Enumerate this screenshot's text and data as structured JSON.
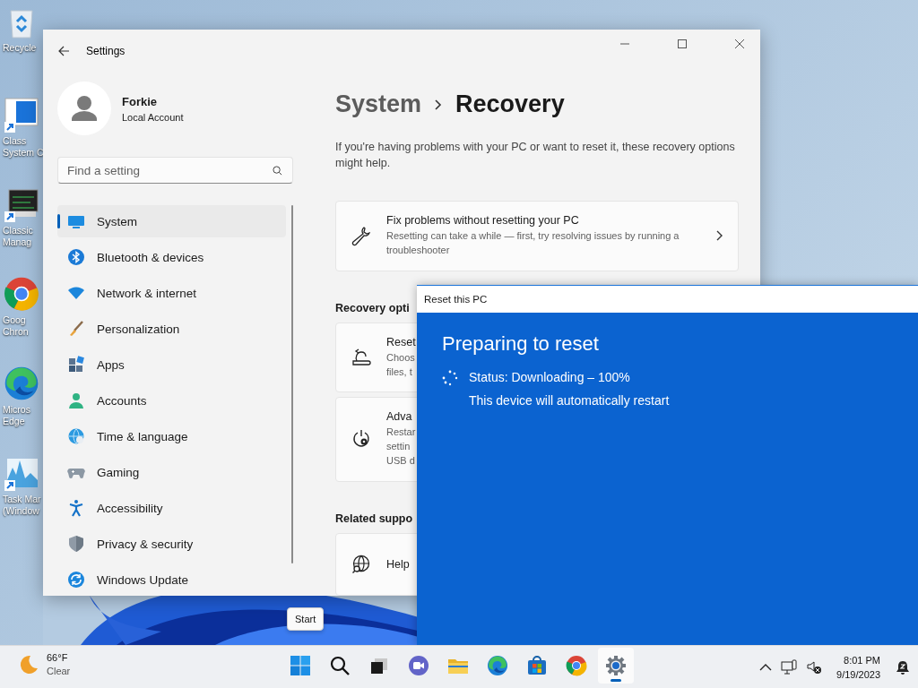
{
  "desktop": {
    "icons": [
      {
        "kind": "recycle",
        "lines": [
          "Recycle"
        ]
      },
      {
        "kind": "system-config",
        "lines": [
          "Class",
          "System C"
        ]
      },
      {
        "kind": "monitor",
        "lines": [
          "Classic",
          "Manag"
        ]
      },
      {
        "kind": "chrome",
        "lines": [
          "Goog",
          "Chron"
        ]
      },
      {
        "kind": "edge",
        "lines": [
          "Micros",
          "Edge"
        ]
      },
      {
        "kind": "taskmgr",
        "lines": [
          "Task Mar",
          "(Window"
        ]
      }
    ]
  },
  "settings_window": {
    "title": "Settings",
    "user": {
      "name": "Forkie",
      "account": "Local Account"
    },
    "search": {
      "placeholder": "Find a setting"
    },
    "nav": [
      {
        "kind": "system",
        "label": "System",
        "selected": true
      },
      {
        "kind": "bluetooth",
        "label": "Bluetooth & devices",
        "selected": false
      },
      {
        "kind": "network",
        "label": "Network & internet",
        "selected": false
      },
      {
        "kind": "brush",
        "label": "Personalization",
        "selected": false
      },
      {
        "kind": "apps",
        "label": "Apps",
        "selected": false
      },
      {
        "kind": "accounts",
        "label": "Accounts",
        "selected": false
      },
      {
        "kind": "time",
        "label": "Time & language",
        "selected": false
      },
      {
        "kind": "gaming",
        "label": "Gaming",
        "selected": false
      },
      {
        "kind": "accessibility",
        "label": "Accessibility",
        "selected": false
      },
      {
        "kind": "privacy",
        "label": "Privacy & security",
        "selected": false
      },
      {
        "kind": "update",
        "label": "Windows Update",
        "selected": false
      }
    ],
    "breadcrumb": {
      "parent": "System",
      "current": "Recovery"
    },
    "description": "If you're having problems with your PC or want to reset it, these recovery options might help.",
    "fix_card": {
      "title": "Fix problems without resetting your PC",
      "description": "Resetting can take a while — first, try resolving issues by running a troubleshooter"
    },
    "recovery_heading": "Recovery opti",
    "recovery_options": [
      {
        "kind": "reset",
        "title": "Reset",
        "lines": [
          "Choos",
          "files, t"
        ]
      },
      {
        "kind": "advanced",
        "title": "Adva",
        "lines": [
          "Restar",
          "settin",
          "USB d"
        ]
      }
    ],
    "related_heading": "Related suppo",
    "related": [
      {
        "kind": "help",
        "title": "Help"
      }
    ]
  },
  "reset_dialog": {
    "title": "Reset this PC",
    "heading": "Preparing to reset",
    "status": "Status: Downloading – 100%",
    "note": "This device will automatically restart"
  },
  "tooltip": "Start",
  "taskbar": {
    "weather": {
      "temperature": "66°F",
      "condition": "Clear"
    },
    "apps": [
      {
        "kind": "start",
        "active": false
      },
      {
        "kind": "search",
        "active": false
      },
      {
        "kind": "taskview",
        "active": false
      },
      {
        "kind": "chat",
        "active": false
      },
      {
        "kind": "explorer",
        "active": false
      },
      {
        "kind": "edge",
        "active": false
      },
      {
        "kind": "store",
        "active": false
      },
      {
        "kind": "chrome",
        "active": false
      },
      {
        "kind": "settings",
        "active": true
      }
    ],
    "clock": {
      "time": "8:01 PM",
      "date": "9/19/2023"
    }
  }
}
